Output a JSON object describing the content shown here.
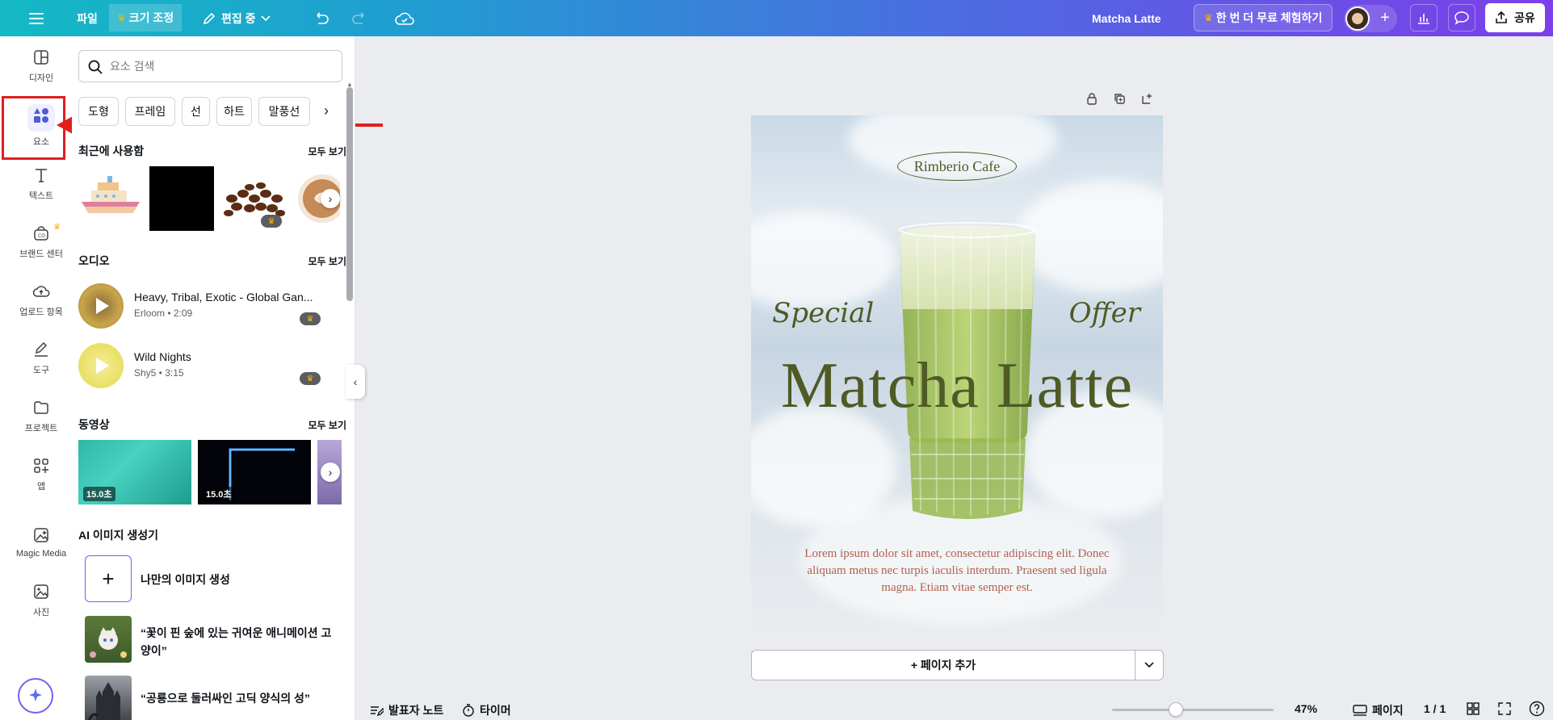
{
  "topbar": {
    "file": "파일",
    "resize": "크기 조정",
    "editing": "편집 중",
    "doc_title": "Matcha Latte",
    "trial": "한 번 더 무료 체험하기",
    "share": "공유"
  },
  "rail": {
    "items": [
      {
        "label": "디자인"
      },
      {
        "label": "요소"
      },
      {
        "label": "텍스트"
      },
      {
        "label": "브랜드 센터"
      },
      {
        "label": "업로드 항목"
      },
      {
        "label": "도구"
      },
      {
        "label": "프로젝트"
      },
      {
        "label": "앱"
      },
      {
        "label": "Magic Media"
      },
      {
        "label": "사진"
      }
    ]
  },
  "panel": {
    "search_placeholder": "요소 검색",
    "chips": [
      "도형",
      "프레임",
      "선",
      "하트",
      "말풍선"
    ],
    "recent": {
      "title": "최근에 사용함",
      "see_all": "모두 보기"
    },
    "audio": {
      "title": "오디오",
      "see_all": "모두 보기",
      "tracks": [
        {
          "name": "Heavy, Tribal, Exotic - Global Gan...",
          "meta": "Erloom • 2:09"
        },
        {
          "name": "Wild Nights",
          "meta": "Shy5 • 3:15"
        }
      ]
    },
    "video": {
      "title": "동영상",
      "see_all": "모두 보기",
      "durations": [
        "15.0초",
        "15.0초"
      ]
    },
    "ai": {
      "title": "AI 이미지 생성기",
      "create": "나만의 이미지 생성",
      "prompts": [
        "“꽃이 핀 숲에 있는 귀여운 애니메이션 고양이”",
        "“공룡으로 둘러싸인 고딕 양식의 성”"
      ]
    }
  },
  "design": {
    "cafe": "Rimberio Cafe",
    "special": "Special",
    "offer": "Offer",
    "title": "Matcha Latte",
    "body": "Lorem ipsum dolor sit amet, consectetur adipiscing elit. Donec aliquam metus nec turpis iaculis interdum. Praesent sed ligula magna. Etiam vitae semper est."
  },
  "add_page": "+ 페이지 추가",
  "bottombar": {
    "notes": "발표자 노트",
    "timer": "타이머",
    "zoom": "47%",
    "pages_label": "페이지",
    "page_count": "1 / 1",
    "zoom_fraction": 0.47
  },
  "colors": {
    "accent": "#7c3fe8",
    "highlight_red": "#e01e1e",
    "design_green": "#4f5a24",
    "lorem_text": "#b2604e"
  }
}
